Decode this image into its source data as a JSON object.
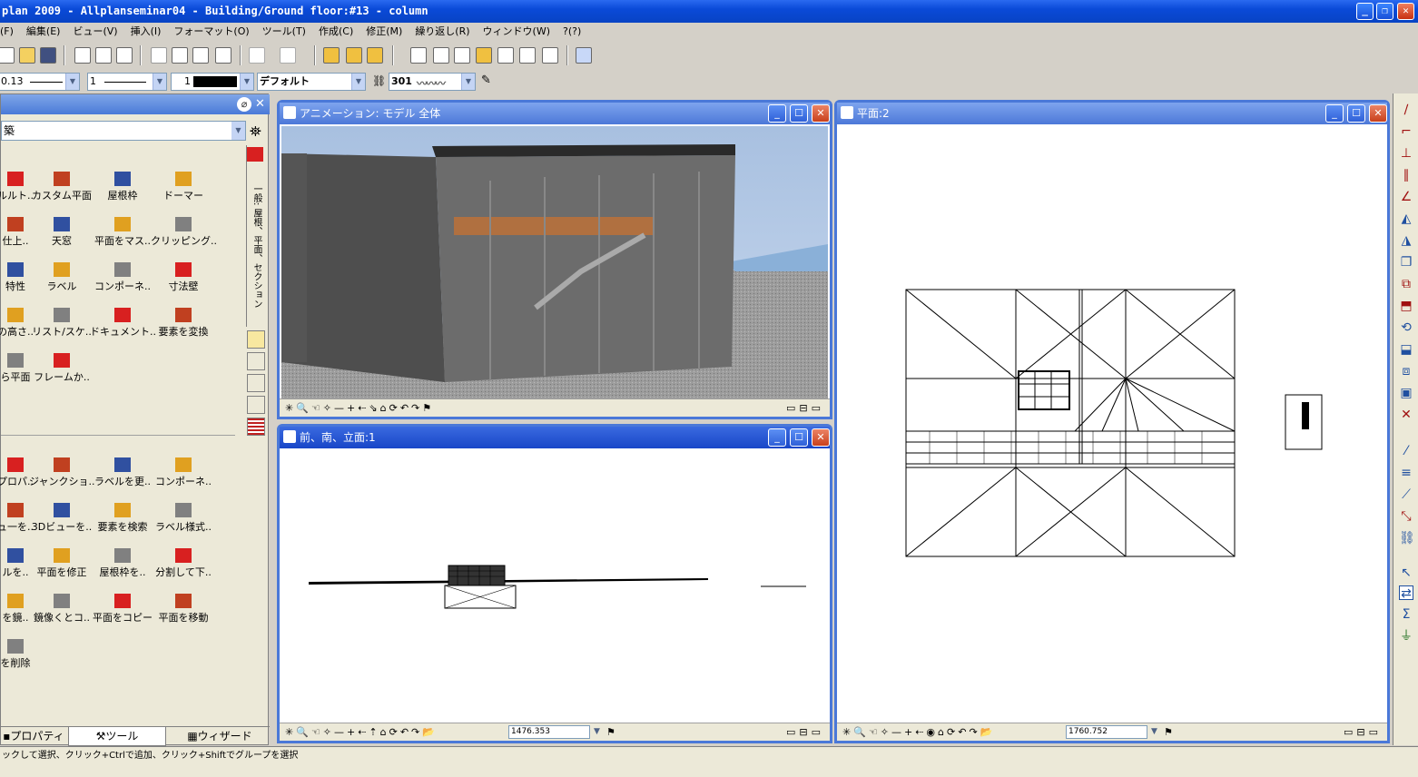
{
  "title": "plan 2009 - Allplanseminar04 - Building/Ground floor:#13 - column",
  "menu": [
    "(F)",
    "編集(E)",
    "ビュー(V)",
    "挿入(I)",
    "フォーマット(O)",
    "ツール(T)",
    "作成(C)",
    "修正(M)",
    "繰り返し(R)",
    "ウィンドウ(W)",
    "?(?)"
  ],
  "toolbar2": {
    "pen": "0.13",
    "line": "1",
    "color": "1",
    "layer": "デフォルト",
    "hatch": "301"
  },
  "palette": {
    "category": "築",
    "vertical_tab": "一般: 屋根、平面、セクション",
    "tools_top": [
      [
        "ルルト..",
        "カスタム平面",
        "屋根枠",
        "ドーマー"
      ],
      [
        "仕上..",
        "天窓",
        "平面をマス..",
        "クリッピング.."
      ],
      [
        "特性",
        "ラベル",
        "コンポーネ..",
        "寸法壁"
      ],
      [
        "の高さ..",
        "リスト/スケ..",
        "ドキュメント..",
        "要素を変換"
      ],
      [
        "ら平面",
        "フレームか.."
      ]
    ],
    "tools_bottom": [
      [
        "プロパ..",
        "ジャンクショ..",
        "ラベルを更..",
        "コンポーネ.."
      ],
      [
        "ュ一を..",
        "3Dビューを..",
        "要素を検索",
        "ラベル様式.."
      ],
      [
        "ルを..",
        "平面を修正",
        "屋根枠を..",
        "分割して下.."
      ],
      [
        "を鏡..",
        "鏡像くとコ..",
        "平面をコピー",
        "平面を移動"
      ],
      [
        "を削除"
      ]
    ],
    "tabs": [
      "プロパティ",
      "ツール",
      "ウィザード"
    ]
  },
  "windows": {
    "animation": {
      "title": "アニメーション: モデル 全体"
    },
    "elevation": {
      "title": "前、南、立面:1",
      "zoom": "1476.353"
    },
    "plan": {
      "title": "平面:2",
      "zoom": "1760.752"
    }
  },
  "status": "ックして選択、クリック+Ctrlで追加、クリック+Shiftでグループを選択",
  "colors": {
    "titlebar": "#0a4ad8",
    "window_title": "#4c78d8",
    "sky": "#b8cce4",
    "concrete": "#4a4a4a"
  }
}
